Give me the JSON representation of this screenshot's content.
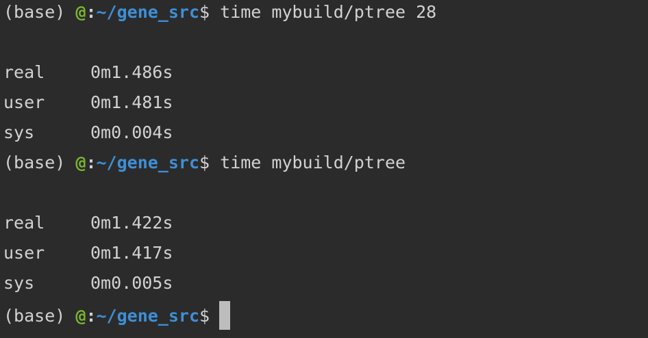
{
  "prompt": {
    "env": "(base)",
    "at": "@",
    "colon": ":",
    "path": "~/gene_src",
    "dollar": "$"
  },
  "commands": [
    {
      "text": "time mybuild/ptree 28",
      "timings": [
        {
          "label": "real",
          "value": "0m1.486s"
        },
        {
          "label": "user",
          "value": "0m1.481s"
        },
        {
          "label": "sys",
          "value": "0m0.004s"
        }
      ]
    },
    {
      "text": "time mybuild/ptree",
      "timings": [
        {
          "label": "real",
          "value": "0m1.422s"
        },
        {
          "label": "user",
          "value": "0m1.417s"
        },
        {
          "label": "sys",
          "value": "0m0.005s"
        }
      ]
    }
  ],
  "colors": {
    "background": "#2b2b2b",
    "text": "#d2d2d2",
    "at_green": "#7ab52d",
    "path_blue": "#3e8fd6",
    "cursor": "#bdbdbd"
  }
}
